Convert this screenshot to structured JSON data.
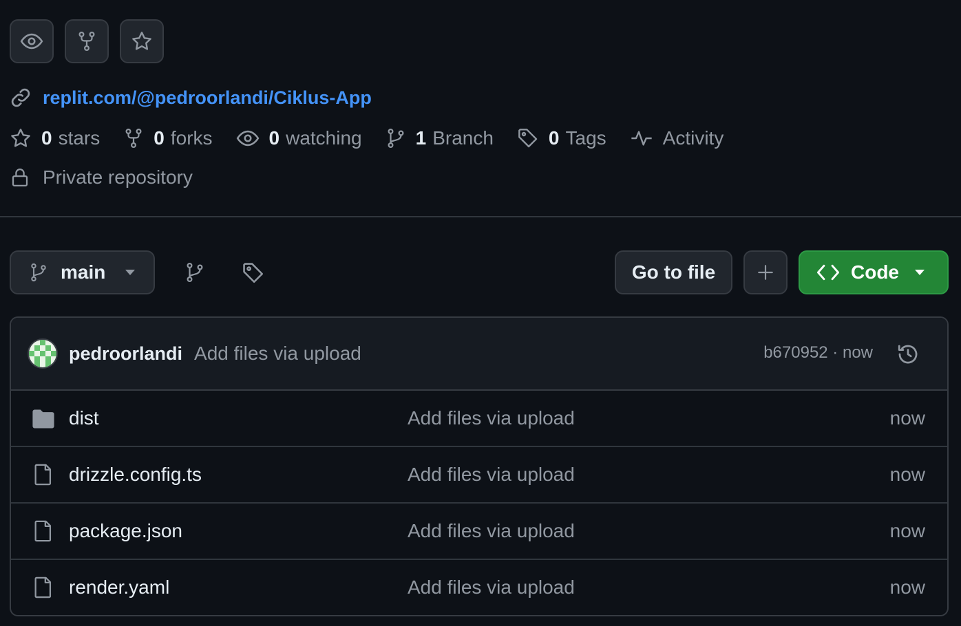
{
  "repo": {
    "website": "replit.com/@pedroorlandi/Ciklus-App",
    "stats": [
      {
        "icon": "star-icon",
        "num": "0",
        "label": "stars"
      },
      {
        "icon": "fork-icon",
        "num": "0",
        "label": "forks"
      },
      {
        "icon": "eye-icon",
        "num": "0",
        "label": "watching"
      },
      {
        "icon": "branch-icon",
        "num": "1",
        "label": "Branch"
      },
      {
        "icon": "tag-icon",
        "num": "0",
        "label": "Tags"
      },
      {
        "icon": "pulse-icon",
        "num": "",
        "label": "Activity"
      }
    ],
    "visibility": "Private repository"
  },
  "toolbar": {
    "branch": "main",
    "go_to_file": "Go to file",
    "code": "Code"
  },
  "commit": {
    "author": "pedroorlandi",
    "message": "Add files via upload",
    "meta": "b670952 · now"
  },
  "files": [
    {
      "type": "folder",
      "icon": "folder-icon",
      "name": "dist",
      "message": "Add files via upload",
      "time": "now"
    },
    {
      "type": "file",
      "icon": "file-icon",
      "name": "drizzle.config.ts",
      "message": "Add files via upload",
      "time": "now"
    },
    {
      "type": "file",
      "icon": "file-icon",
      "name": "package.json",
      "message": "Add files via upload",
      "time": "now"
    },
    {
      "type": "file",
      "icon": "file-icon",
      "name": "render.yaml",
      "message": "Add files via upload",
      "time": "now"
    }
  ],
  "colors": {
    "background": "#0d1117",
    "link": "#4493f8",
    "code_button": "#238636",
    "muted_text": "#9198a1"
  }
}
